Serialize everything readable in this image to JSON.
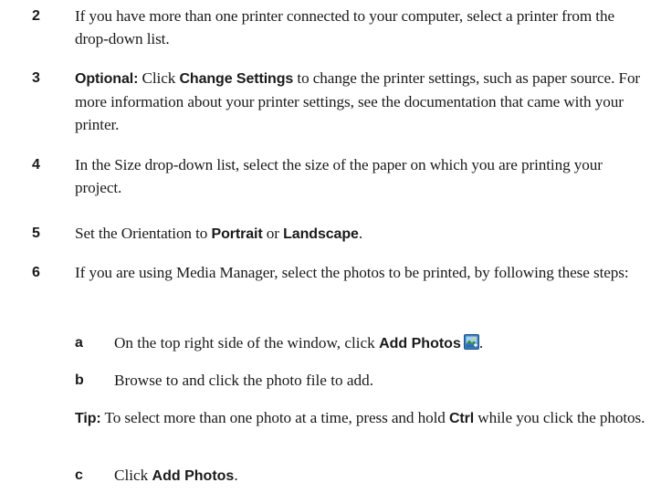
{
  "steps": [
    {
      "num": "2",
      "text": "If you have more than one printer connected to your computer, select a printer from the drop-down list."
    },
    {
      "num": "3",
      "lead": "Optional:",
      "t1": " Click ",
      "bold1": "Change Settings",
      "t2": " to change the printer settings, such as paper source. For more information about your printer settings, see the documentation that came with your printer."
    },
    {
      "num": "4",
      "text": "In the Size drop-down list, select the size of the paper on which you are printing your project."
    },
    {
      "num": "5",
      "t1": "Set the Orientation to ",
      "bold1": "Portrait",
      "t2": " or ",
      "bold2": "Landscape",
      "t3": "."
    },
    {
      "num": "6",
      "text": "If you are using Media Manager, select the photos to be printed, by following these steps:"
    }
  ],
  "substeps": [
    {
      "letter": "a",
      "t1": "On the top right side of the window, click ",
      "bold1": "Add Photos",
      "icon": "add-photos-icon",
      "t2": "."
    },
    {
      "letter": "b",
      "text": "Browse to and click the photo file to add."
    },
    {
      "letter": "c",
      "t1": "Click ",
      "bold1": "Add Photos",
      "t2": "."
    }
  ],
  "tip": {
    "label": "Tip:",
    "t1": "  To select more than one photo at a time, press and hold ",
    "bold1": "Ctrl",
    "t2": " while you click the photos."
  }
}
